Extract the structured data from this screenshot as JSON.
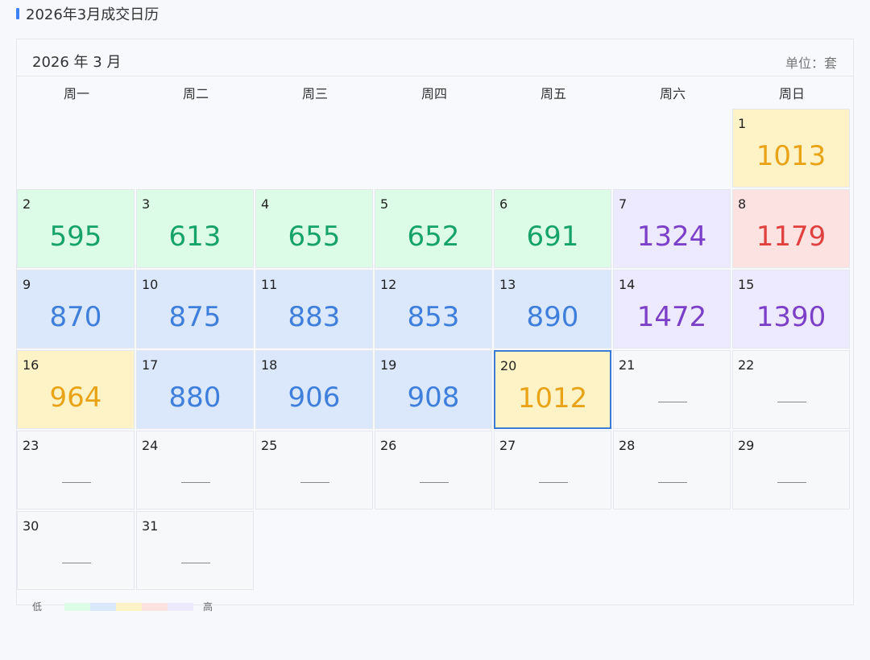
{
  "page": {
    "title": "2026年3月成交日历"
  },
  "calendar": {
    "month_label": "2026 年 3 月",
    "unit_label": "单位：套",
    "weekdays": [
      "周一",
      "周二",
      "周三",
      "周四",
      "周五",
      "周六",
      "周日"
    ],
    "selected_day": 20,
    "days": [
      {
        "day": 1,
        "value": 1013,
        "level": "yellow"
      },
      {
        "day": 2,
        "value": 595,
        "level": "green"
      },
      {
        "day": 3,
        "value": 613,
        "level": "green"
      },
      {
        "day": 4,
        "value": 655,
        "level": "green"
      },
      {
        "day": 5,
        "value": 652,
        "level": "green"
      },
      {
        "day": 6,
        "value": 691,
        "level": "green"
      },
      {
        "day": 7,
        "value": 1324,
        "level": "purple"
      },
      {
        "day": 8,
        "value": 1179,
        "level": "red"
      },
      {
        "day": 9,
        "value": 870,
        "level": "blue"
      },
      {
        "day": 10,
        "value": 875,
        "level": "blue"
      },
      {
        "day": 11,
        "value": 883,
        "level": "blue"
      },
      {
        "day": 12,
        "value": 853,
        "level": "blue"
      },
      {
        "day": 13,
        "value": 890,
        "level": "blue"
      },
      {
        "day": 14,
        "value": 1472,
        "level": "purple"
      },
      {
        "day": 15,
        "value": 1390,
        "level": "purple"
      },
      {
        "day": 16,
        "value": 964,
        "level": "yellow"
      },
      {
        "day": 17,
        "value": 880,
        "level": "blue"
      },
      {
        "day": 18,
        "value": 906,
        "level": "blue"
      },
      {
        "day": 19,
        "value": 908,
        "level": "blue"
      },
      {
        "day": 20,
        "value": 1012,
        "level": "yellow"
      },
      {
        "day": 21,
        "value": null,
        "level": "empty"
      },
      {
        "day": 22,
        "value": null,
        "level": "empty"
      },
      {
        "day": 23,
        "value": null,
        "level": "empty"
      },
      {
        "day": 24,
        "value": null,
        "level": "empty"
      },
      {
        "day": 25,
        "value": null,
        "level": "empty"
      },
      {
        "day": 26,
        "value": null,
        "level": "empty"
      },
      {
        "day": 27,
        "value": null,
        "level": "empty"
      },
      {
        "day": 28,
        "value": null,
        "level": "empty"
      },
      {
        "day": 29,
        "value": null,
        "level": "empty"
      },
      {
        "day": 30,
        "value": null,
        "level": "empty"
      },
      {
        "day": 31,
        "value": null,
        "level": "empty"
      }
    ]
  },
  "legend": {
    "low_label": "低",
    "high_label": "高",
    "colors": [
      "#dcfce7",
      "#dbe8fc",
      "#fef3c7",
      "#fde2e2",
      "#ede9fe"
    ]
  }
}
